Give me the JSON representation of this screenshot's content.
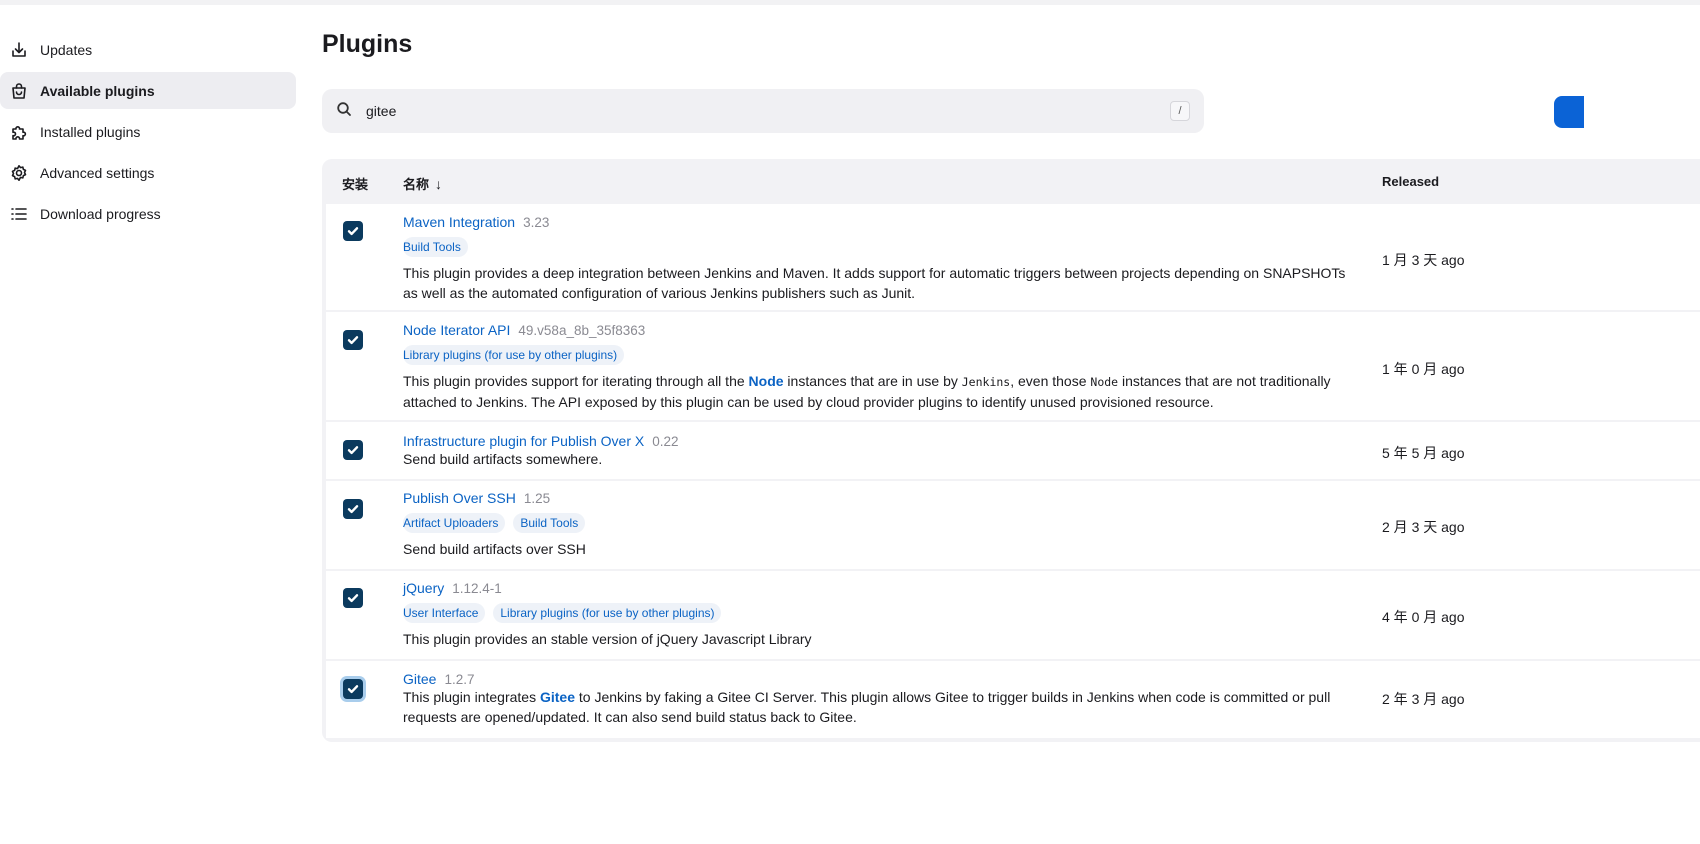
{
  "sidebar": {
    "items": [
      {
        "label": "Updates",
        "icon": "download-icon"
      },
      {
        "label": "Available plugins",
        "icon": "shopping-bag-icon"
      },
      {
        "label": "Installed plugins",
        "icon": "puzzle-icon"
      },
      {
        "label": "Advanced settings",
        "icon": "gear-icon"
      },
      {
        "label": "Download progress",
        "icon": "list-icon"
      }
    ]
  },
  "main": {
    "title": "Plugins",
    "search": {
      "value": "gitee",
      "shortcut": "/"
    }
  },
  "table": {
    "headers": {
      "install": "安装",
      "name": "名称",
      "sort_arrow": "↓",
      "released": "Released"
    },
    "rows": [
      {
        "name": "Maven Integration",
        "version": "3.23",
        "tags": [
          "Build Tools"
        ],
        "desc": "This plugin provides a deep integration between Jenkins and Maven. It adds support for automatic triggers between projects depending on SNAPSHOTs as well as the automated configuration of various Jenkins publishers such as Junit.",
        "released": "1 月 3 天 ago"
      },
      {
        "name": "Node Iterator API",
        "version": "49.v58a_8b_35f8363",
        "tags": [
          "Library plugins (for use by other plugins)"
        ],
        "desc_parts": {
          "p1": "This plugin provides support for iterating through all the ",
          "b1": "Node",
          "p2": " instances that are in use by ",
          "c1": "Jenkins",
          "p3": ", even those ",
          "c2": "Node",
          "p4": " instances that are not traditionally attached to Jenkins. The API exposed by this plugin can be used by cloud provider plugins to identify unused provisioned resource."
        },
        "released": "1 年 0 月 ago"
      },
      {
        "name": "Infrastructure plugin for Publish Over X",
        "version": "0.22",
        "tags": [],
        "desc": "Send build artifacts somewhere.",
        "released": "5 年 5 月 ago"
      },
      {
        "name": "Publish Over SSH",
        "version": "1.25",
        "tags": [
          "Artifact Uploaders",
          "Build Tools"
        ],
        "desc": "Send build artifacts over SSH",
        "released": "2 月 3 天 ago"
      },
      {
        "name": "jQuery",
        "version": "1.12.4-1",
        "tags": [
          "User Interface",
          "Library plugins (for use by other plugins)"
        ],
        "desc": "This plugin provides an stable version of jQuery Javascript Library",
        "released": "4 年 0 月 ago"
      },
      {
        "name": "Gitee",
        "version": "1.2.7",
        "tags": [],
        "desc_parts": {
          "p1": "This plugin integrates ",
          "b1": "Gitee",
          "p2": " to Jenkins by faking a Gitee CI Server. This plugin allows Gitee to trigger builds in Jenkins when code is committed or pull requests are opened/updated. It can also send build status back to Gitee."
        },
        "released": "2 年 3 月 ago"
      }
    ]
  },
  "colors": {
    "accent": "#0b63c4",
    "checkbox": "#0b3a5e",
    "primary_button": "#0b63d6"
  }
}
